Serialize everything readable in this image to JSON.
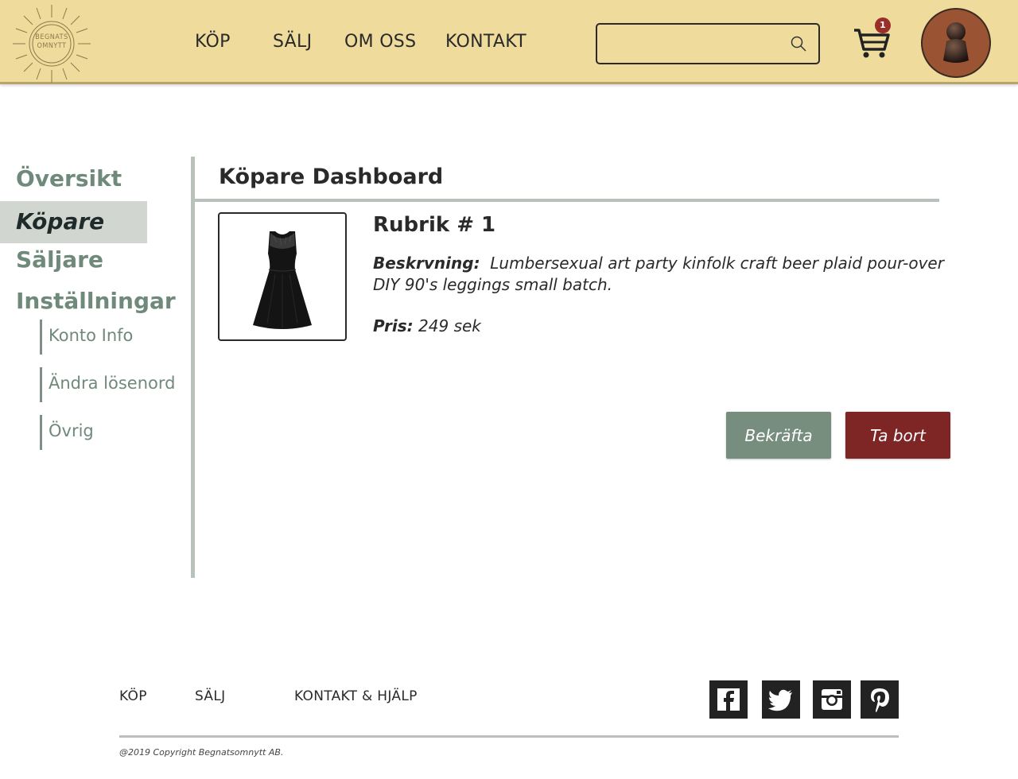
{
  "header": {
    "logo_text_line1": "BEGNATS",
    "logo_text_line2": "OMNYTT",
    "nav": [
      "KÖP",
      "SÄLJ",
      "OM OSS",
      "KONTAKT"
    ],
    "search": {
      "value": "",
      "placeholder": ""
    },
    "cart_count": "1",
    "icons": {
      "search": "search-icon",
      "cart": "cart-icon",
      "avatar": "user-avatar-icon"
    }
  },
  "sidebar": {
    "items": [
      {
        "label": "Översikt",
        "active": false
      },
      {
        "label": "Köpare",
        "active": true
      },
      {
        "label": "Säljare",
        "active": false
      },
      {
        "label": "Inställningar",
        "active": false
      }
    ],
    "sub_items": [
      "Konto Info",
      "Ändra lösenord",
      "Övrig"
    ]
  },
  "main": {
    "title": "Köpare Dashboard",
    "product": {
      "image": "black-dress-image",
      "title": "Rubrik # 1",
      "desc_label": "Beskrvning:",
      "desc_text": "Lumbersexual art party kinfolk craft beer plaid pour-over DIY 90's leggings small batch.",
      "price_label": "Pris:",
      "price_value": "249 sek"
    },
    "buttons": {
      "confirm": "Bekräfta",
      "delete": "Ta bort"
    }
  },
  "footer": {
    "links": [
      "KÖP",
      "SÄLJ",
      "KONTAKT & HJÄLP"
    ],
    "social": [
      "facebook-icon",
      "twitter-icon",
      "instagram-icon",
      "pinterest-icon"
    ],
    "copyright": "@2019 Copyright Begnatsomnytt AB."
  },
  "colors": {
    "header_bg": "#efdc9c",
    "sidebar_text": "#6f8a7a",
    "active_bg": "#d1d6d0",
    "confirm": "#778e7f",
    "delete": "#7e2626",
    "badge": "#9a2f2a"
  }
}
